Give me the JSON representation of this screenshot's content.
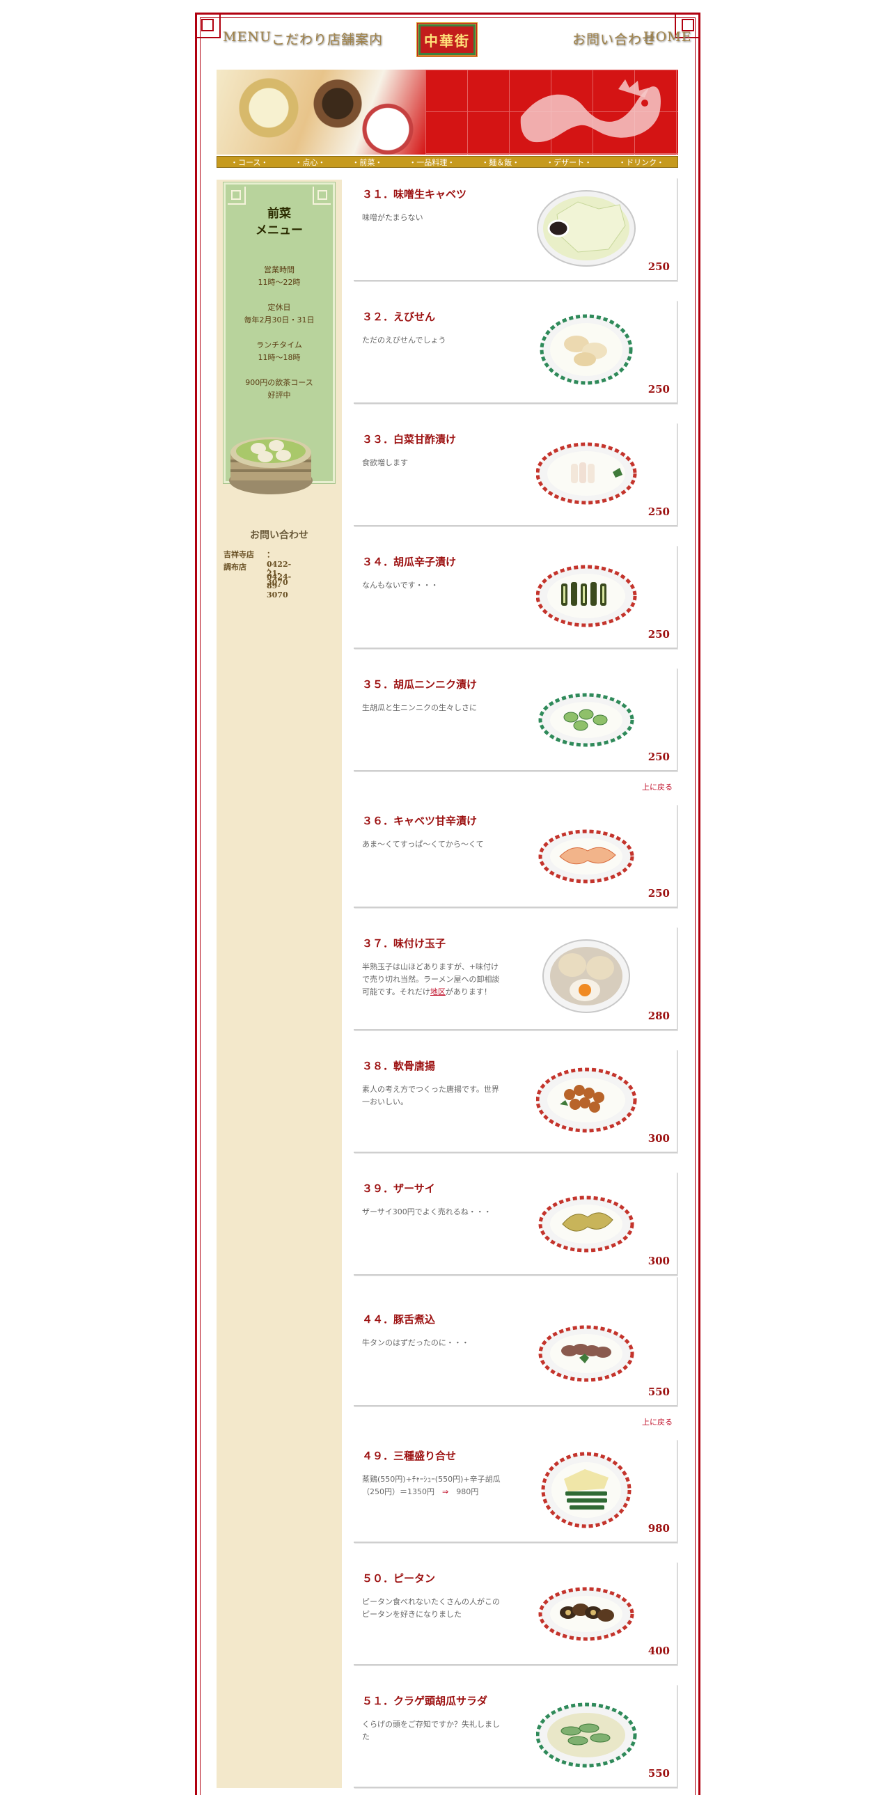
{
  "nav": {
    "menu": "MENU",
    "kodawari": "こだわり",
    "tenpo": "店舗案内",
    "logo": "中華街",
    "contact": "お問い合わせ",
    "home": "HOME"
  },
  "categories": [
    "・コース・",
    "・点心・",
    "・前菜・",
    "・一品料理・",
    "・麺＆飯・",
    "・デザート・",
    "・ドリンク・"
  ],
  "sidebar": {
    "title": "前菜\nメニュー",
    "hours": "営業時間\n11時～22時",
    "closed": "定休日\n毎年2月30日・31日",
    "lunch": "ランチタイム\n11時～18時",
    "course": "900円の飲茶コース\n好評中",
    "contact_heading": "お問い合わせ",
    "stores": [
      {
        "name": "吉祥寺店",
        "phone": "：0422-21-3070"
      },
      {
        "name": "調布店",
        "phone": "：0424-89-3070"
      }
    ]
  },
  "back_to_top": "上に戻る",
  "items": [
    {
      "title": "３１．味噌生キャベツ",
      "desc": "味噌がたまらない",
      "price": "250",
      "dish": "cabbage"
    },
    {
      "title": "３２．えびせん",
      "desc": "ただのえびせんでしょう",
      "price": "250",
      "dish": "ebisen"
    },
    {
      "title": "３３．白菜甘酢漬け",
      "desc": "食欲増します",
      "price": "250",
      "dish": "hakusai"
    },
    {
      "title": "３４．胡瓜辛子漬け",
      "desc": "なんもないです・・・",
      "price": "250",
      "dish": "kyuri-karashi"
    },
    {
      "title": "３５．胡瓜ニンニク漬け",
      "desc": "生胡瓜と生ニンニクの生々しさに",
      "price": "250",
      "dish": "kyuri-ninniku"
    },
    {
      "title": "３６．キャベツ甘辛漬け",
      "desc": "あま～くてすっぱ～くてから～くて",
      "price": "250",
      "dish": "cabbage-amakara"
    },
    {
      "title": "３７．味付け玉子",
      "desc_a": "半熟玉子は山ほどありますが、+味付け\nで売り切れ当然。ラーメン屋への卸相談\n可能です。それだけ",
      "desc_link": "地区",
      "desc_b": "があります！",
      "price": "280",
      "dish": "egg"
    },
    {
      "title": "３８．軟骨唐揚",
      "desc": "素人の考え方でつくった唐揚です。世界\n一おいしい。",
      "price": "300",
      "dish": "karaage"
    },
    {
      "title": "３９．ザーサイ",
      "desc": "ザーサイ300円でよく売れるね・・・",
      "price": "300",
      "dish": "zasai"
    },
    {
      "title": "４４．豚舌煮込",
      "desc": "牛タンのはずだったのに・・・",
      "price": "550",
      "dish": "tongue"
    },
    {
      "title": "４９．三種盛り合せ",
      "desc_a": "蒸鶏(550円)+ﾁｬｰｼｭｰ(550円)+辛子胡瓜\n（250円）＝1350円　",
      "desc_link": "⇒",
      "desc_b": "　980円",
      "price": "980",
      "dish": "sanshu"
    },
    {
      "title": "５０．ピータン",
      "desc": "ピータン食べれないたくさんの人がこの\nピータンを好きになりました",
      "price": "400",
      "dish": "pidan"
    },
    {
      "title": "５１．クラゲ頭胡瓜サラダ",
      "desc": "くらげの頭をご存知ですか？失礼しまし\nた",
      "price": "550",
      "dish": "kurage"
    }
  ]
}
